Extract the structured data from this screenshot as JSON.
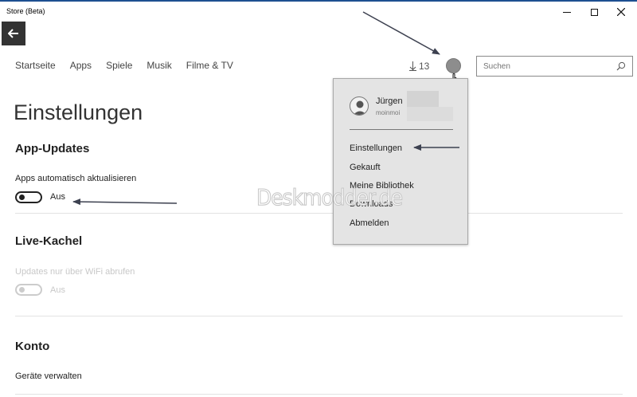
{
  "window": {
    "title": "Store (Beta)"
  },
  "nav": {
    "items": [
      "Startseite",
      "Apps",
      "Spiele",
      "Musik",
      "Filme & TV"
    ],
    "downloads_count": "13"
  },
  "search": {
    "placeholder": "Suchen"
  },
  "page": {
    "title": "Einstellungen"
  },
  "sections": {
    "app_updates": {
      "heading": "App-Updates",
      "setting_label": "Apps automatisch aktualisieren",
      "toggle_state": "Aus"
    },
    "live_tile": {
      "heading": "Live-Kachel",
      "setting_label": "Updates nur über WiFi abrufen",
      "toggle_state": "Aus"
    },
    "account": {
      "heading": "Konto",
      "link": "Geräte verwalten"
    }
  },
  "account_menu": {
    "user_name": "Jürgen",
    "user_email": "moinmoi",
    "items": [
      "Einstellungen",
      "Gekauft",
      "Meine Bibliothek",
      "Downloads",
      "Abmelden"
    ]
  },
  "watermark": "Deskmodder.de",
  "icons": {
    "back": "arrow-left-icon",
    "download": "download-arrow-icon",
    "search": "magnifier-icon",
    "user": "user-silhouette-icon"
  },
  "colors": {
    "title_line": "#1d4f91",
    "back_button": "#333333",
    "menu_background": "#e4e4e4",
    "annotation_arrow": "#3d4150"
  }
}
